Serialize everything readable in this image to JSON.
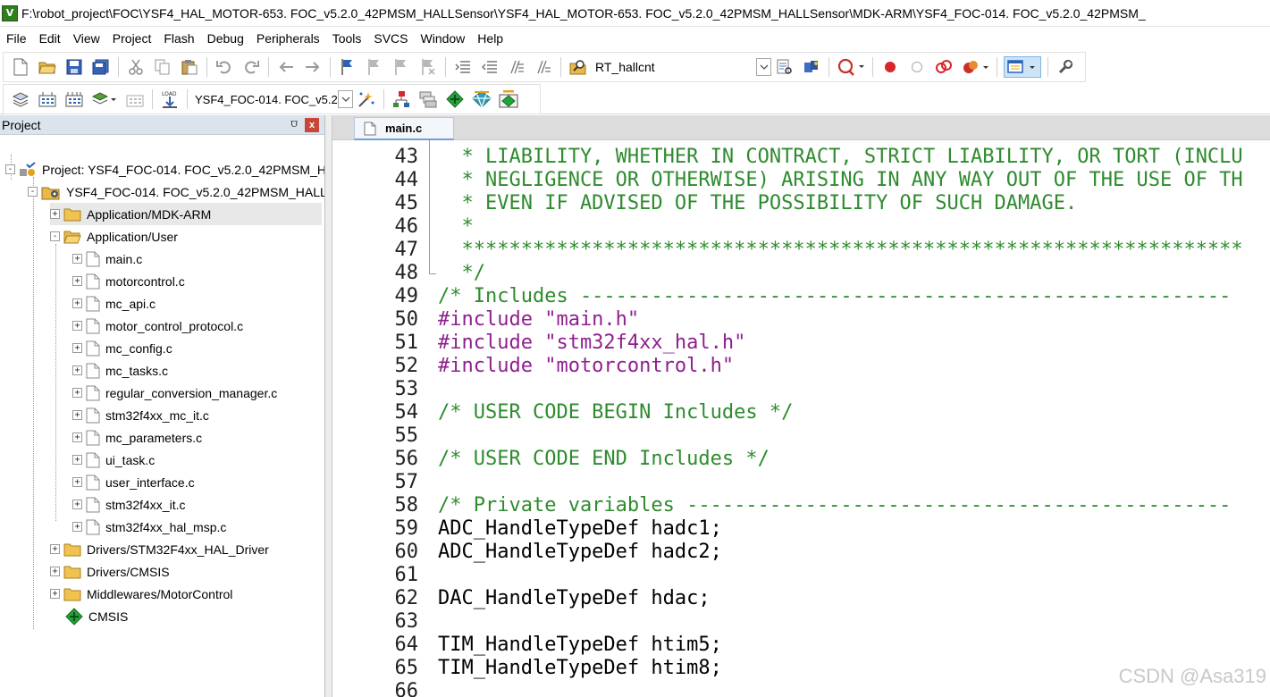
{
  "window": {
    "logo_text": "V",
    "title": "F:\\robot_project\\FOC\\YSF4_HAL_MOTOR-653. FOC_v5.2.0_42PMSM_HALLSensor\\YSF4_HAL_MOTOR-653. FOC_v5.2.0_42PMSM_HALLSensor\\MDK-ARM\\YSF4_FOC-014. FOC_v5.2.0_42PMSM_"
  },
  "menu": [
    "File",
    "Edit",
    "View",
    "Project",
    "Flash",
    "Debug",
    "Peripherals",
    "Tools",
    "SVCS",
    "Window",
    "Help"
  ],
  "toolbar": {
    "find_combo_value": "RT_hallcnt",
    "target_combo_value": "YSF4_FOC-014. FOC_v5.2"
  },
  "project_panel": {
    "title": "Project",
    "pin_glyph": "⩌",
    "close_glyph": "x",
    "tree": [
      {
        "label": "Project: YSF4_FOC-014. FOC_v5.2.0_42PMSM_H",
        "expander": "-"
      },
      {
        "label": "YSF4_FOC-014. FOC_v5.2.0_42PMSM_HALL",
        "expander": "-"
      },
      {
        "label": "Application/MDK-ARM",
        "expander": "+"
      },
      {
        "label": "Application/User",
        "expander": "-"
      },
      {
        "label": "main.c",
        "expander": "+"
      },
      {
        "label": "motorcontrol.c",
        "expander": "+"
      },
      {
        "label": "mc_api.c",
        "expander": "+"
      },
      {
        "label": "motor_control_protocol.c",
        "expander": "+"
      },
      {
        "label": "mc_config.c",
        "expander": "+"
      },
      {
        "label": "mc_tasks.c",
        "expander": "+"
      },
      {
        "label": "regular_conversion_manager.c",
        "expander": "+"
      },
      {
        "label": "stm32f4xx_mc_it.c",
        "expander": "+"
      },
      {
        "label": "mc_parameters.c",
        "expander": "+"
      },
      {
        "label": "ui_task.c",
        "expander": "+"
      },
      {
        "label": "user_interface.c",
        "expander": "+"
      },
      {
        "label": "stm32f4xx_it.c",
        "expander": "+"
      },
      {
        "label": "stm32f4xx_hal_msp.c",
        "expander": "+"
      },
      {
        "label": "Drivers/STM32F4xx_HAL_Driver",
        "expander": "+"
      },
      {
        "label": "Drivers/CMSIS",
        "expander": "+"
      },
      {
        "label": "Middlewares/MotorControl",
        "expander": "+"
      },
      {
        "label": "CMSIS",
        "expander": ""
      }
    ]
  },
  "editor": {
    "active_tab": "main.c",
    "line_numbers": [
      "43",
      "44",
      "45",
      "46",
      "47",
      "48",
      "49",
      "50",
      "51",
      "52",
      "53",
      "54",
      "55",
      "56",
      "57",
      "58",
      "59",
      "60",
      "61",
      "62",
      "63",
      "64",
      "65",
      "66"
    ],
    "lines": [
      "  * LIABILITY, WHETHER IN CONTRACT, STRICT LIABILITY, OR TORT (INCLU",
      "  * NEGLIGENCE OR OTHERWISE) ARISING IN ANY WAY OUT OF THE USE OF TH",
      "  * EVEN IF ADVISED OF THE POSSIBILITY OF SUCH DAMAGE.",
      "  *",
      "  ******************************************************************",
      "  */",
      "/* Includes -------------------------------------------------------",
      "#include \"main.h\"",
      "#include \"stm32f4xx_hal.h\"",
      "#include \"motorcontrol.h\"",
      "",
      "/* USER CODE BEGIN Includes */",
      "",
      "/* USER CODE END Includes */",
      "",
      "/* Private variables ----------------------------------------------",
      "ADC_HandleTypeDef hadc1;",
      "ADC_HandleTypeDef hadc2;",
      "",
      "DAC_HandleTypeDef hdac;",
      "",
      "TIM_HandleTypeDef htim5;",
      "TIM_HandleTypeDef htim8;",
      ""
    ]
  },
  "watermark": "CSDN @Asa319"
}
